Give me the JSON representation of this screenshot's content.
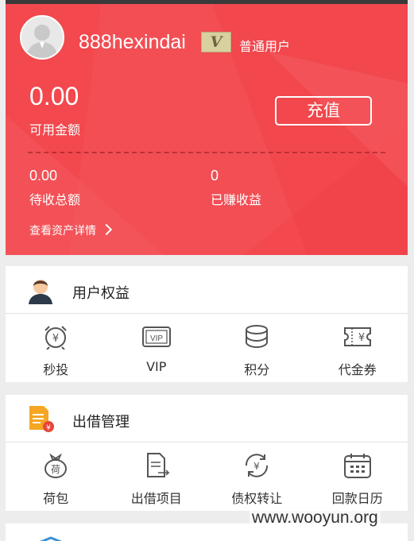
{
  "header": {
    "username": "888hexindai",
    "vip_badge": "V",
    "user_type": "普通用户",
    "balance": "0.00",
    "balance_label": "可用金额",
    "recharge_label": "充值",
    "pending_value": "0.00",
    "pending_label": "待收总额",
    "earned_value": "0",
    "earned_label": "已赚收益",
    "detail_link": "查看资产详情"
  },
  "benefits": {
    "title": "用户权益",
    "items": [
      {
        "label": "秒投",
        "icon": "alarm-clock-yen-icon"
      },
      {
        "label": "VIP",
        "icon": "vip-card-icon"
      },
      {
        "label": "积分",
        "icon": "coins-stack-icon"
      },
      {
        "label": "代金券",
        "icon": "voucher-icon"
      }
    ]
  },
  "lending": {
    "title": "出借管理",
    "items": [
      {
        "label": "荷包",
        "icon": "purse-icon",
        "icon_text": "荷"
      },
      {
        "label": "出借项目",
        "icon": "document-icon"
      },
      {
        "label": "债权转让",
        "icon": "yen-transfer-icon"
      },
      {
        "label": "回款日历",
        "icon": "calendar-icon"
      }
    ]
  },
  "watermark": "www.wooyun.org",
  "colors": {
    "brand": "#f2484e",
    "badge": "#d9d0a0",
    "icon_orange": "#f5a623"
  }
}
